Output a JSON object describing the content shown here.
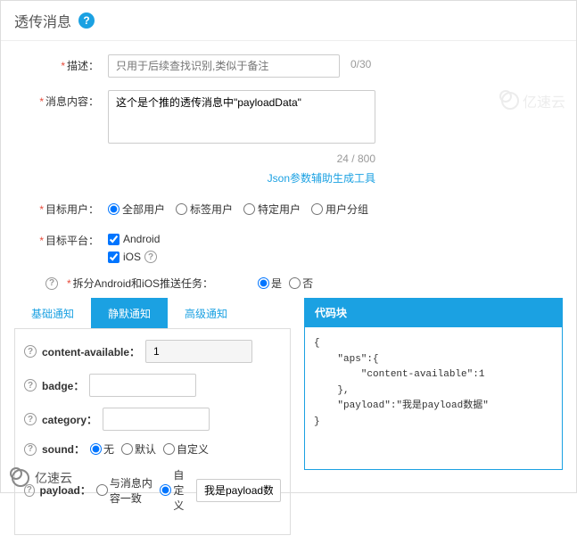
{
  "header": {
    "title": "透传消息"
  },
  "form": {
    "desc": {
      "label": "描述：",
      "placeholder": "只用于后续查找识别,类似于备注",
      "counter": "0/30"
    },
    "content": {
      "label": "消息内容：",
      "value": "这个是个推的透传消息中\"payloadData\"",
      "counter": "24 / 800",
      "helper": "Json参数辅助生成工具"
    },
    "target_user": {
      "label": "目标用户：",
      "options": [
        "全部用户",
        "标签用户",
        "特定用户",
        "用户分组"
      ],
      "selected": 0
    },
    "target_platform": {
      "label": "目标平台：",
      "options": [
        "Android",
        "iOS"
      ]
    },
    "split": {
      "label": "拆分Android和iOS推送任务：",
      "options": [
        "是",
        "否"
      ],
      "selected": 0
    }
  },
  "tabs": {
    "items": [
      "基础通知",
      "静默通知",
      "高级通知"
    ],
    "active": 1
  },
  "silent": {
    "content_available": {
      "label": "content-available：",
      "value": "1"
    },
    "badge": {
      "label": "badge：",
      "value": ""
    },
    "category": {
      "label": "category：",
      "value": ""
    },
    "sound": {
      "label": "sound：",
      "options": [
        "无",
        "默认",
        "自定义"
      ],
      "selected": 0
    },
    "payload": {
      "label": "payload：",
      "options": [
        "与消息内容一致",
        "自定义"
      ],
      "selected": 1,
      "value": "我是payload数据"
    }
  },
  "code": {
    "title": "代码块",
    "body": "{\n    \"aps\":{\n        \"content-available\":1\n    },\n    \"payload\":\"我是payload数据\"\n}"
  },
  "brand": "亿速云"
}
